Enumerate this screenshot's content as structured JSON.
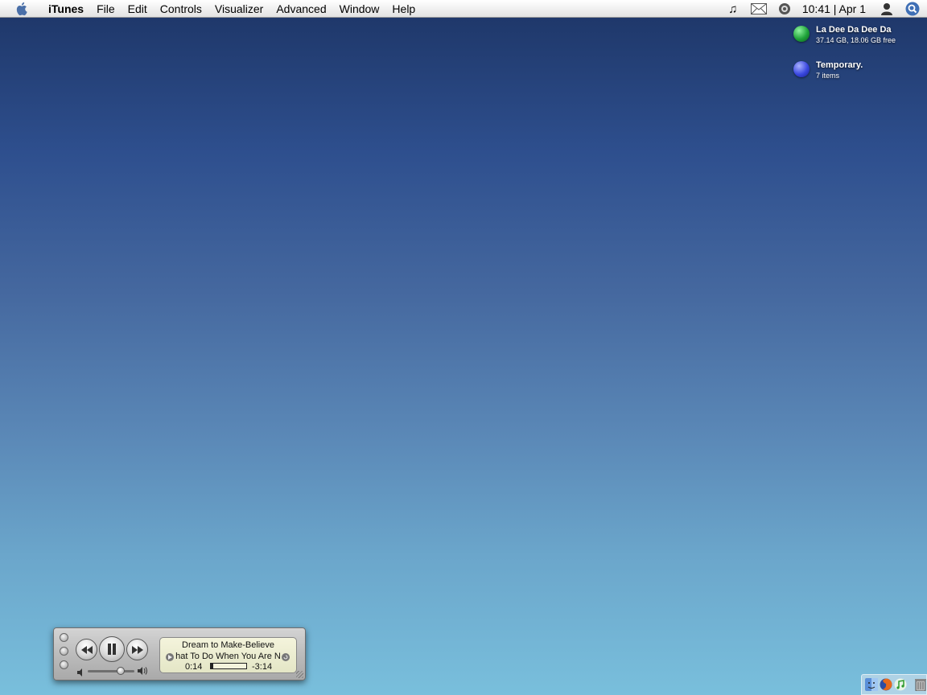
{
  "menubar": {
    "app_name": "iTunes",
    "menus": [
      "File",
      "Edit",
      "Controls",
      "Visualizer",
      "Advanced",
      "Window",
      "Help"
    ],
    "clock": "10:41 | Apr 1",
    "status_icons": [
      "music-note-icon",
      "mail-icon",
      "network-icon",
      "user-icon",
      "spotlight-icon"
    ]
  },
  "desktop": {
    "volumes": [
      {
        "name": "La Dee Da Dee Da",
        "detail": "37.14 GB, 18.06 GB free",
        "color": "#1fa33a"
      },
      {
        "name": "Temporary.",
        "detail": "7 items",
        "color": "#3a48e0"
      }
    ]
  },
  "mini_player": {
    "track_title": "Dream to Make-Believe",
    "track_subtitle": "hat To Do When You Are N",
    "elapsed": "0:14",
    "remaining": "-3:14",
    "progress": 0.07,
    "volume": 0.7
  },
  "dock": {
    "icons": [
      "finder-icon",
      "firefox-icon",
      "itunes-icon",
      "trash-icon"
    ]
  },
  "colors": {
    "accent": "#2e4f8e"
  }
}
